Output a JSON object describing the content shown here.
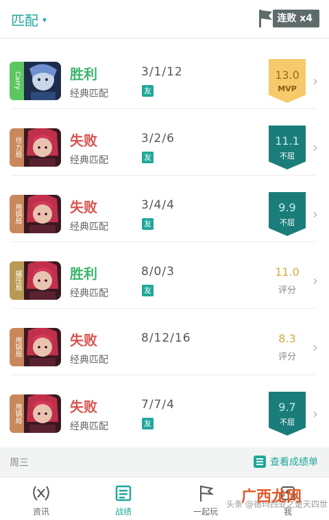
{
  "header": {
    "filter_label": "匹配",
    "streak_label": "连败 x4"
  },
  "matches": [
    {
      "role": "Carry",
      "role_style": "carry",
      "result": "胜利",
      "result_style": "win",
      "mode": "经典匹配",
      "kda": "3/1/12",
      "tag": "友",
      "score": "13.0",
      "score_label": "MVP",
      "score_style": "mvp",
      "hero": "blue"
    },
    {
      "role": "尽力局",
      "role_style": "brown",
      "result": "失败",
      "result_style": "lose",
      "mode": "经典匹配",
      "kda": "3/2/6",
      "tag": "友",
      "score": "11.1",
      "score_label": "不屈",
      "score_style": "bad",
      "hero": "red"
    },
    {
      "role": "甩锅局",
      "role_style": "brown",
      "result": "失败",
      "result_style": "lose",
      "mode": "经典匹配",
      "kda": "3/4/4",
      "tag": "友",
      "score": "9.9",
      "score_label": "不屈",
      "score_style": "bad",
      "hero": "red"
    },
    {
      "role": "碾压局",
      "role_style": "press",
      "result": "胜利",
      "result_style": "win",
      "mode": "经典匹配",
      "kda": "8/0/3",
      "tag": "友",
      "score": "11.0",
      "score_label": "评分",
      "score_style": "plain",
      "hero": "red"
    },
    {
      "role": "甩锅局",
      "role_style": "brown",
      "result": "失败",
      "result_style": "lose",
      "mode": "经典匹配",
      "kda": "8/12/16",
      "tag": "",
      "score": "8.3",
      "score_label": "评分",
      "score_style": "plain",
      "hero": "red"
    },
    {
      "role": "甩锅局",
      "role_style": "brown",
      "result": "失败",
      "result_style": "lose",
      "mode": "经典匹配",
      "kda": "7/7/4",
      "tag": "友",
      "score": "9.7",
      "score_label": "不屈",
      "score_style": "bad",
      "hero": "red"
    }
  ],
  "footer_bar": {
    "day_label": "周三",
    "link_label": "查看成绩单"
  },
  "tabs": [
    {
      "label": "资讯",
      "icon": "wreath-icon",
      "active": false
    },
    {
      "label": "战绩",
      "icon": "scoreboard-icon",
      "active": true
    },
    {
      "label": "一起玩",
      "icon": "flag-icon",
      "active": false
    },
    {
      "label": "我",
      "icon": "profile-icon",
      "active": false
    }
  ],
  "watermark": {
    "text": "头条 @德玛西亚之楚天四世",
    "brand": "广西龙网"
  },
  "colors": {
    "accent": "#1fa79b",
    "win": "#3ab56a",
    "lose": "#d9534f",
    "mvp_badge": "#f6c96b",
    "bad_badge": "#1b7d7a"
  }
}
